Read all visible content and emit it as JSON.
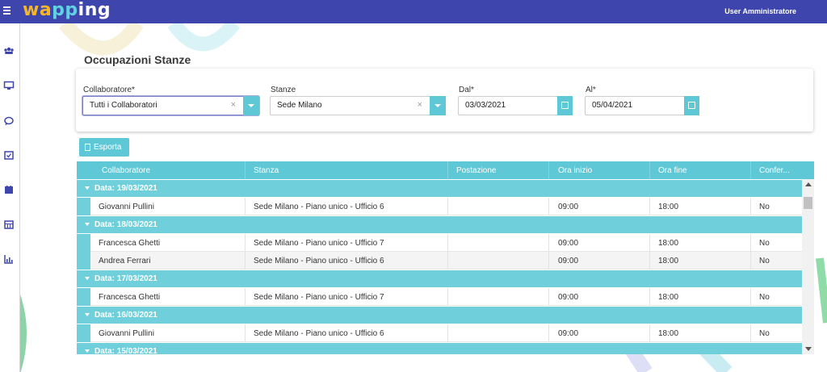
{
  "header": {
    "logo": [
      "wa",
      "pp",
      "ing"
    ],
    "user": "User Amministratore"
  },
  "sidebar": {
    "icons": [
      "users-icon",
      "monitor-icon",
      "chat-icon",
      "calendar-check-icon",
      "calendar-icon",
      "calendar-grid-icon",
      "chart-icon"
    ]
  },
  "page": {
    "title": "Occupazioni Stanze"
  },
  "filters": {
    "collaboratore_label": "Collaboratore*",
    "collaboratore_value": "Tutti i Collaboratori",
    "stanze_label": "Stanze",
    "stanze_value": "Sede Milano",
    "dal_label": "Dal*",
    "dal_value": "03/03/2021",
    "al_label": "Al*",
    "al_value": "05/04/2021",
    "clear_glyph": "×"
  },
  "toolbar": {
    "export_label": "Esporta"
  },
  "grid": {
    "columns": [
      "Collaboratore",
      "Stanza",
      "Postazione",
      "Ora inizio",
      "Ora fine",
      "Confer..."
    ],
    "groups": [
      {
        "label": "Data: 19/03/2021",
        "rows": [
          {
            "collaboratore": "Giovanni Pullini",
            "stanza": "Sede Milano - Piano unico - Ufficio 6",
            "postazione": "",
            "inizio": "09:00",
            "fine": "18:00",
            "conferma": "No"
          }
        ]
      },
      {
        "label": "Data: 18/03/2021",
        "rows": [
          {
            "collaboratore": "Francesca Ghetti",
            "stanza": "Sede Milano - Piano unico - Ufficio 7",
            "postazione": "",
            "inizio": "09:00",
            "fine": "18:00",
            "conferma": "No"
          },
          {
            "collaboratore": "Andrea Ferrari",
            "stanza": "Sede Milano - Piano unico - Ufficio 6",
            "postazione": "",
            "inizio": "09:00",
            "fine": "18:00",
            "conferma": "No"
          }
        ]
      },
      {
        "label": "Data: 17/03/2021",
        "rows": [
          {
            "collaboratore": "Francesca Ghetti",
            "stanza": "Sede Milano - Piano unico - Ufficio 7",
            "postazione": "",
            "inizio": "09:00",
            "fine": "18:00",
            "conferma": "No"
          }
        ]
      },
      {
        "label": "Data: 16/03/2021",
        "rows": [
          {
            "collaboratore": "Giovanni Pullini",
            "stanza": "Sede Milano - Piano unico - Ufficio 6",
            "postazione": "",
            "inizio": "09:00",
            "fine": "18:00",
            "conferma": "No"
          }
        ]
      },
      {
        "label": "Data: 15/03/2021",
        "rows": []
      }
    ]
  }
}
